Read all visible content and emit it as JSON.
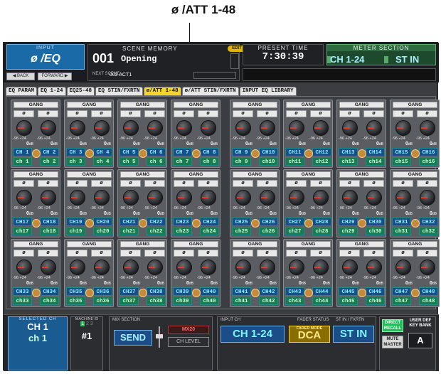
{
  "callout": {
    "label": "ø /ATT 1-48"
  },
  "header": {
    "input_title": "INPUT",
    "input_value": "ø /EQ",
    "back_label": "◀ BACK",
    "forward_label": "FORWARD ▶",
    "scene_title": "SCENE MEMORY",
    "scene_number": "001",
    "scene_name": "Opening",
    "edit_badge": "EDIT",
    "next_label": "NEXT SCENE",
    "next_scene": "002 ACT1",
    "time_title": "PRESENT TIME",
    "time_value": "7:30:39",
    "meter_title": "METER SECTION",
    "meter_a": "CH 1-24",
    "meter_b": "ST IN"
  },
  "tabs": [
    {
      "label": "EQ PARAM",
      "active": false
    },
    {
      "label": "EQ 1-24",
      "active": false
    },
    {
      "label": "EQ25-48",
      "active": false
    },
    {
      "label": "EQ STIN/FXRTN",
      "active": false
    },
    {
      "label": "ø/ATT 1-48",
      "active": true
    },
    {
      "label": "ø/ATT STIN/FXRTN",
      "active": false
    },
    {
      "label": "INPUT EQ LIBRARY",
      "active": false
    }
  ],
  "channel_labels": {
    "gang": "GANG",
    "phase": "ø",
    "range_lo": "-96",
    "range_hi": "+24",
    "value": "0",
    "unit": "dB"
  },
  "groups": [
    {
      "c1": "CH 1",
      "c2": "CH 2",
      "n1": "ch 1",
      "n2": "ch 2"
    },
    {
      "c1": "CH 3",
      "c2": "CH 4",
      "n1": "ch 3",
      "n2": "ch 4"
    },
    {
      "c1": "CH 5",
      "c2": "CH 6",
      "n1": "ch 5",
      "n2": "ch 6"
    },
    {
      "c1": "CH 7",
      "c2": "CH 8",
      "n1": "ch 7",
      "n2": "ch 8"
    },
    {
      "c1": "CH 9",
      "c2": "CH10",
      "n1": "ch 9",
      "n2": "ch10"
    },
    {
      "c1": "CH11",
      "c2": "CH12",
      "n1": "ch11",
      "n2": "ch12"
    },
    {
      "c1": "CH13",
      "c2": "CH14",
      "n1": "ch13",
      "n2": "ch14"
    },
    {
      "c1": "CH15",
      "c2": "CH16",
      "n1": "ch15",
      "n2": "ch16"
    },
    {
      "c1": "CH17",
      "c2": "CH18",
      "n1": "ch17",
      "n2": "ch18"
    },
    {
      "c1": "CH19",
      "c2": "CH20",
      "n1": "ch19",
      "n2": "ch20"
    },
    {
      "c1": "CH21",
      "c2": "CH22",
      "n1": "ch21",
      "n2": "ch22"
    },
    {
      "c1": "CH23",
      "c2": "CH24",
      "n1": "ch23",
      "n2": "ch24"
    },
    {
      "c1": "CH25",
      "c2": "CH26",
      "n1": "ch25",
      "n2": "ch26"
    },
    {
      "c1": "CH27",
      "c2": "CH28",
      "n1": "ch27",
      "n2": "ch28"
    },
    {
      "c1": "CH29",
      "c2": "CH30",
      "n1": "ch29",
      "n2": "ch30"
    },
    {
      "c1": "CH31",
      "c2": "CH32",
      "n1": "ch31",
      "n2": "ch32"
    },
    {
      "c1": "CH33",
      "c2": "CH34",
      "n1": "ch33",
      "n2": "ch34"
    },
    {
      "c1": "CH35",
      "c2": "CH36",
      "n1": "ch35",
      "n2": "ch36"
    },
    {
      "c1": "CH37",
      "c2": "CH38",
      "n1": "ch37",
      "n2": "ch38"
    },
    {
      "c1": "CH39",
      "c2": "CH40",
      "n1": "ch39",
      "n2": "ch40"
    },
    {
      "c1": "CH41",
      "c2": "CH42",
      "n1": "ch41",
      "n2": "ch42"
    },
    {
      "c1": "CH43",
      "c2": "CH44",
      "n1": "ch43",
      "n2": "ch44"
    },
    {
      "c1": "CH45",
      "c2": "CH46",
      "n1": "ch45",
      "n2": "ch46"
    },
    {
      "c1": "CH47",
      "c2": "CH48",
      "n1": "ch47",
      "n2": "ch48"
    }
  ],
  "footer": {
    "selected_title": "SELECTED CH",
    "selected_a": "CH 1",
    "selected_b": "ch 1",
    "machine_title": "MACHINE ID",
    "machine_nums": [
      "1",
      "2",
      "3"
    ],
    "machine_id": "#1",
    "mix_title": "MIX SECTION",
    "send_label": "SEND",
    "mix_name": "MX20",
    "chlevel_label": "CH LEVEL",
    "input_ch_title": "INPUT CH",
    "fader_status_title": "FADER STATUS",
    "stin_title": "ST IN / FXRTN",
    "input_ch_value": "CH 1-24",
    "fader_mode_label": "FADER MODE",
    "fader_mode_value": "DCA",
    "stin_value": "ST IN",
    "direct_recall": "DIRECT RECALL",
    "user_def": "USER DEF KEY BANK",
    "mute_master": "MUTE MASTER",
    "bank_value": "A"
  }
}
